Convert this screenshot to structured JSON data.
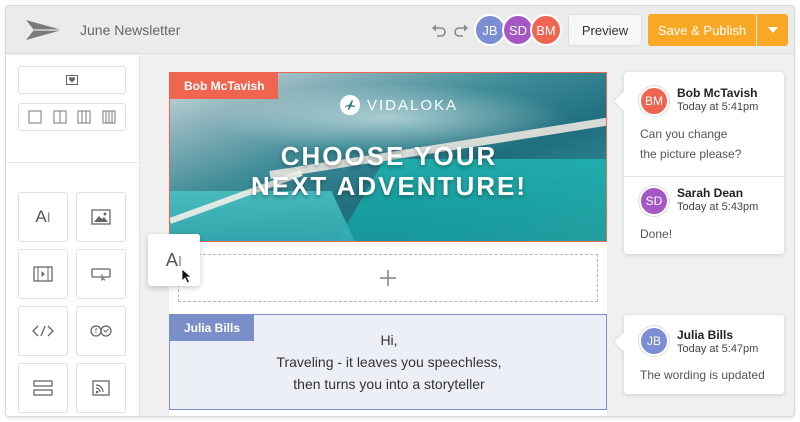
{
  "header": {
    "title": "June Newsletter",
    "preview_label": "Preview",
    "publish_label": "Save & Publish",
    "collaborators": [
      {
        "initials": "JB",
        "color": "#7b8ed1"
      },
      {
        "initials": "SD",
        "color": "#a557c4"
      },
      {
        "initials": "BM",
        "color": "#f0654f"
      }
    ]
  },
  "sidebar": {
    "tools": [
      "text-block-icon",
      "image-block-icon",
      "video-block-icon",
      "button-block-icon",
      "html-block-icon",
      "social-block-icon",
      "divider-block-icon",
      "rss-block-icon"
    ],
    "drag_ghost_label": "A"
  },
  "canvas": {
    "hero": {
      "author_tag": "Bob McTavish",
      "brand": "VIDALOKA",
      "headline_line1": "CHOOSE YOUR",
      "headline_line2": "NEXT ADVENTURE!"
    },
    "text_block": {
      "author_tag": "Julia Bills",
      "line1": "Hi,",
      "line2": "Traveling - it leaves you speechless,",
      "line3": "then turns you into a storyteller"
    }
  },
  "comments": {
    "thread1": [
      {
        "initials": "BM",
        "color": "#f0654f",
        "name": "Bob McTavish",
        "time": "Today at 5:41pm",
        "text_line1": "Can you change",
        "text_line2": "the picture please?"
      },
      {
        "initials": "SD",
        "color": "#a557c4",
        "name": "Sarah Dean",
        "time": "Today at 5:43pm",
        "text_line1": "Done!"
      }
    ],
    "thread2": [
      {
        "initials": "JB",
        "color": "#7b8ed1",
        "name": "Julia Bills",
        "time": "Today at 5:47pm",
        "text_line1": "The wording is updated"
      }
    ]
  },
  "colors": {
    "accent": "#f9a825",
    "bob": "#f0654f",
    "julia": "#7a8fc9"
  }
}
